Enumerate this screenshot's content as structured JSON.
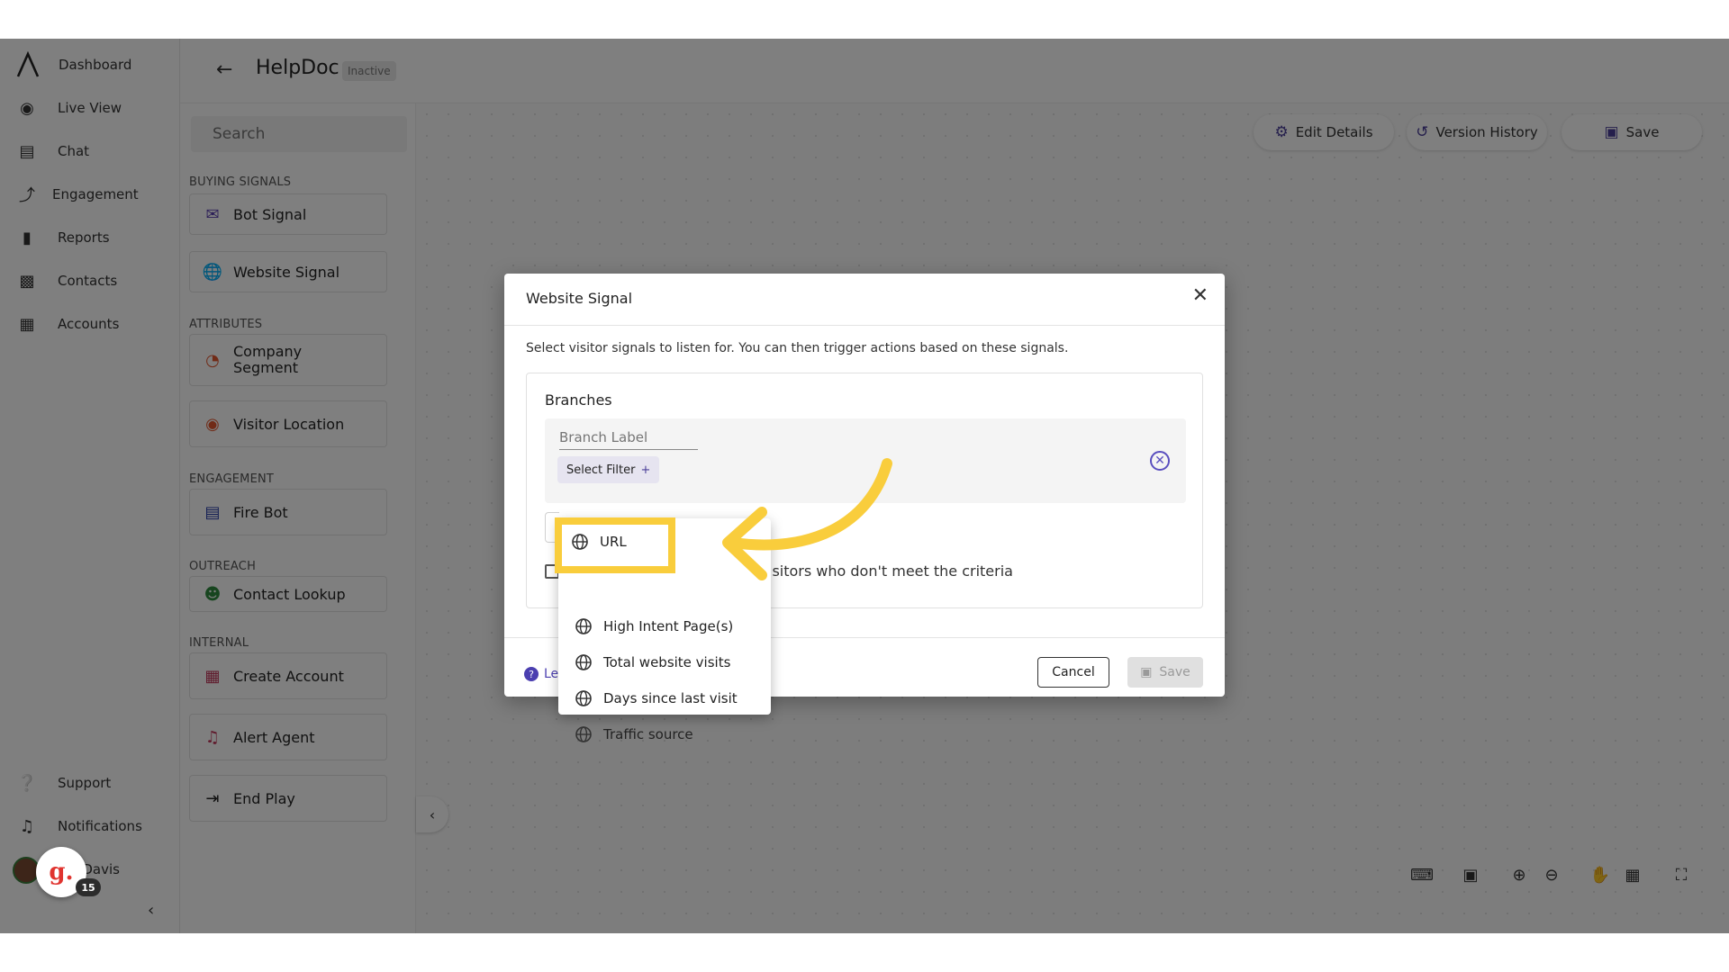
{
  "nav": {
    "brand": "Dashboard",
    "items": [
      {
        "label": "Live View",
        "icon": "live-view-icon"
      },
      {
        "label": "Chat",
        "icon": "chat-icon"
      },
      {
        "label": "Engagement",
        "icon": "engagement-icon"
      },
      {
        "label": "Reports",
        "icon": "reports-icon"
      },
      {
        "label": "Contacts",
        "icon": "contacts-icon"
      },
      {
        "label": "Accounts",
        "icon": "accounts-icon"
      }
    ],
    "support": "Support",
    "notifications": "Notifications",
    "user_name": "ael Davis",
    "help_badge_count": "15",
    "help_logo": "g."
  },
  "header": {
    "title": "HelpDoc",
    "status": "Inactive"
  },
  "palette": {
    "search_placeholder": "Search",
    "sections": {
      "buying_signals": "BUYING SIGNALS",
      "attributes": "ATTRIBUTES",
      "engagement": "ENGAGEMENT",
      "outreach": "OUTREACH",
      "internal": "INTERNAL"
    },
    "items": {
      "bot_signal": "Bot Signal",
      "website_signal": "Website Signal",
      "company_segment": "Company Segment",
      "visitor_location": "Visitor Location",
      "fire_bot": "Fire Bot",
      "contact_lookup": "Contact Lookup",
      "create_account": "Create Account",
      "alert_agent": "Alert Agent",
      "end_play": "End Play"
    }
  },
  "toolbar": {
    "edit_details": "Edit Details",
    "version_history": "Version History",
    "save": "Save"
  },
  "modal": {
    "title": "Website Signal",
    "description": "Select visitor signals to listen for. You can then trigger actions based on these signals.",
    "branches_title": "Branches",
    "branch_label_placeholder": "Branch Label",
    "select_filter": "Select Filter",
    "else_label": "isitors who don't meet the criteria",
    "learn_more": "Le",
    "cancel": "Cancel",
    "save": "Save"
  },
  "dropdown": {
    "options": [
      "URL",
      "High Intent Page(s)",
      "Total website visits",
      "Days since last visit",
      "Traffic source"
    ]
  },
  "colors": {
    "accent": "#4b3f99",
    "highlight": "#f9cd3c"
  }
}
